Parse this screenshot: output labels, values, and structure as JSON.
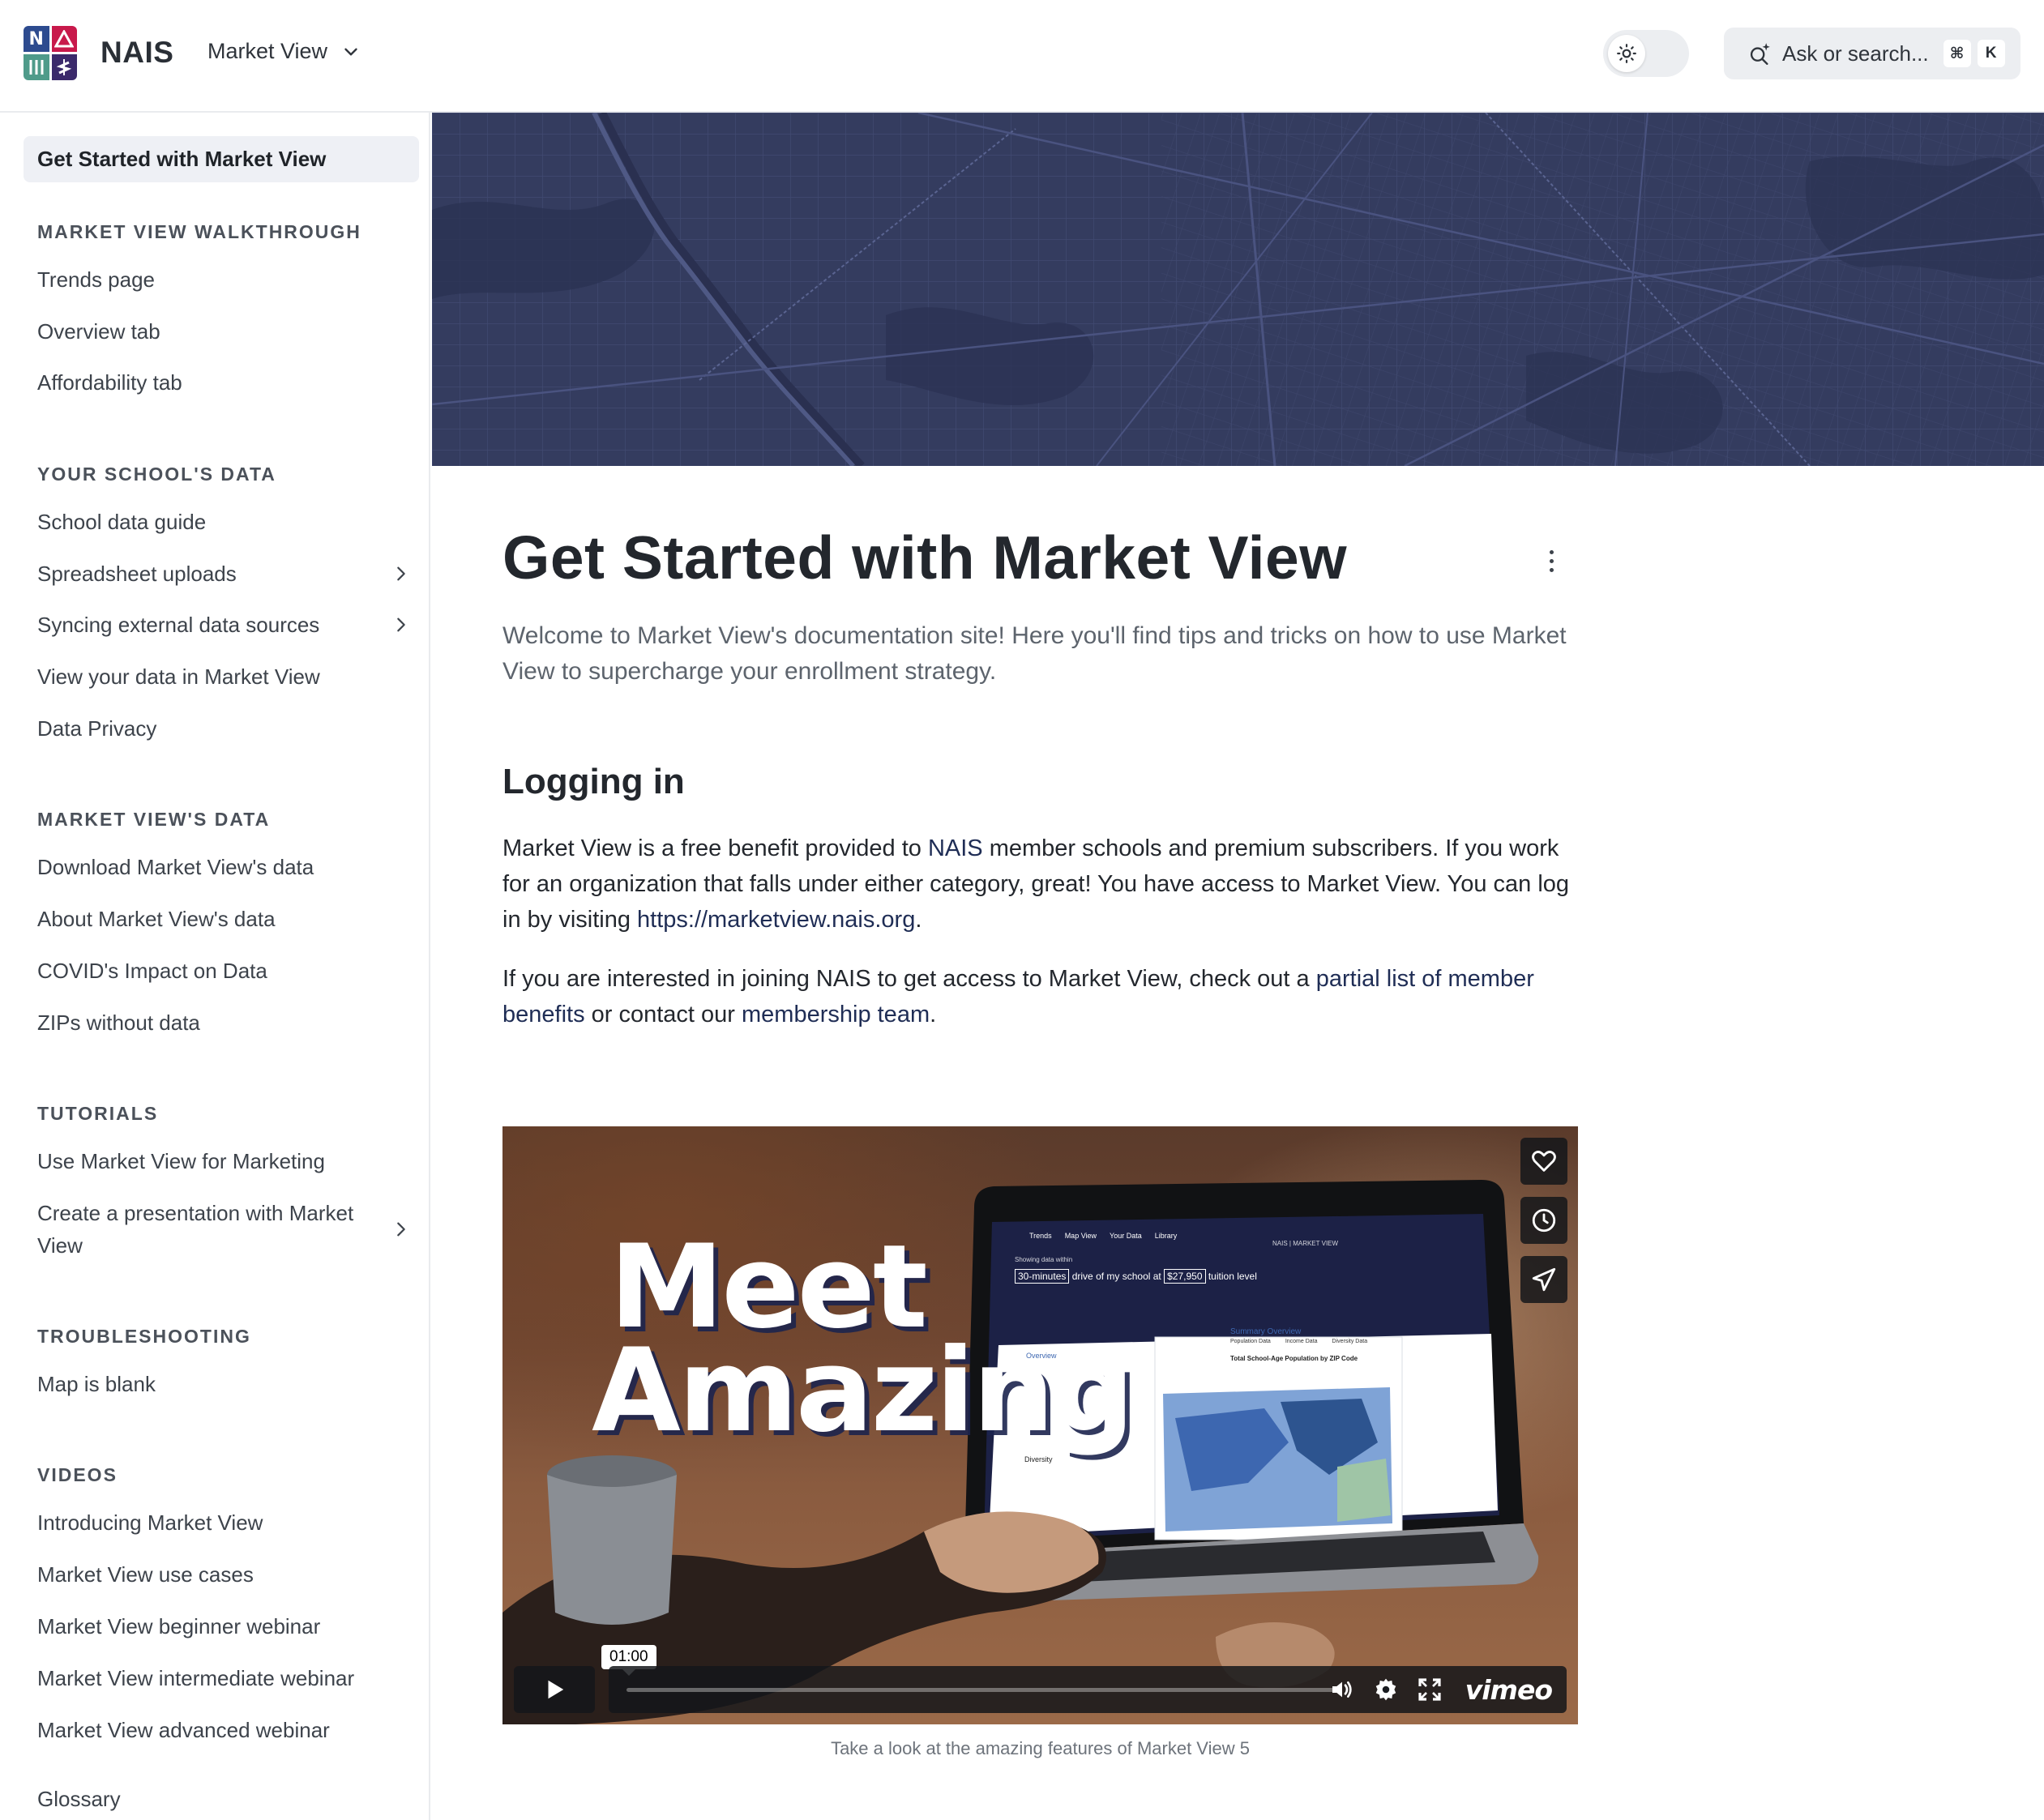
{
  "header": {
    "logo_letters": [
      "N",
      "A",
      "|||",
      "$"
    ],
    "brand": "NAIS",
    "space_switcher": "Market View",
    "search": {
      "label": "Ask or search...",
      "shortcut_mod": "⌘",
      "shortcut_key": "K"
    }
  },
  "sidebar": {
    "active": "Get Started with Market View",
    "sections": [
      {
        "title": "MARKET VIEW WALKTHROUGH",
        "items": [
          "Trends page",
          "Overview tab",
          "Affordability tab"
        ]
      },
      {
        "title": "YOUR SCHOOL'S DATA",
        "items": [
          "School data guide",
          "Spreadsheet uploads",
          "Syncing external data sources",
          "View your data in Market View",
          "Data Privacy"
        ]
      },
      {
        "title": "MARKET VIEW'S DATA",
        "items": [
          "Download Market View's data",
          "About Market View's data",
          "COVID's Impact on Data",
          "ZIPs without data"
        ]
      },
      {
        "title": "TUTORIALS",
        "items": [
          "Use Market View for Marketing",
          "Create a presentation with Market View"
        ]
      },
      {
        "title": "TROUBLESHOOTING",
        "items": [
          "Map is blank"
        ]
      },
      {
        "title": "VIDEOS",
        "items": [
          "Introducing Market View",
          "Market View use cases",
          "Market View beginner webinar",
          "Market View intermediate webinar",
          "Market View advanced webinar"
        ]
      }
    ],
    "footer_item": "Glossary"
  },
  "page": {
    "title": "Get Started with Market View",
    "lead": "Welcome to Market View's documentation site! Here you'll find tips and tricks on how to use Market View to supercharge your enrollment strategy.",
    "section_heading": "Logging in",
    "para1": {
      "t1": "Market View is a free benefit provided to ",
      "link1": "NAIS",
      "t2": " member schools and premium subscribers. If you work for an organization that falls under either category, great! You have access to Market View. You can log in by visiting ",
      "link2": "https://marketview.nais.org",
      "t3": "."
    },
    "para2": {
      "t1": "If you are interested in joining NAIS to get access to Market View, check out a ",
      "link1": "partial list of member benefits",
      "t2": " or contact our ",
      "link2": "membership team",
      "t3": "."
    }
  },
  "video": {
    "headline_line1": "Meet",
    "headline_line2": "Amazing",
    "time_tooltip": "01:00",
    "brand": "vimeo",
    "caption": "Take a look at the amazing features of Market View 5",
    "screen": {
      "nav": [
        "Trends",
        "Map View",
        "Your Data",
        "Library"
      ],
      "brand": "NAIS | MARKET VIEW",
      "filter_prefix": "Showing data within",
      "filter_drive": "30-minutes",
      "filter_mid": "drive of my school at",
      "filter_tuition": "$27,950",
      "filter_suffix": "tuition level",
      "panel_title": "Summary Overview",
      "panel_tabs": [
        "Population Data",
        "Income Data",
        "Diversity Data"
      ],
      "panel_chart_title": "Total School-Age Population by ZIP Code",
      "left_heading": "Overview",
      "left_item": "Diversity"
    }
  }
}
